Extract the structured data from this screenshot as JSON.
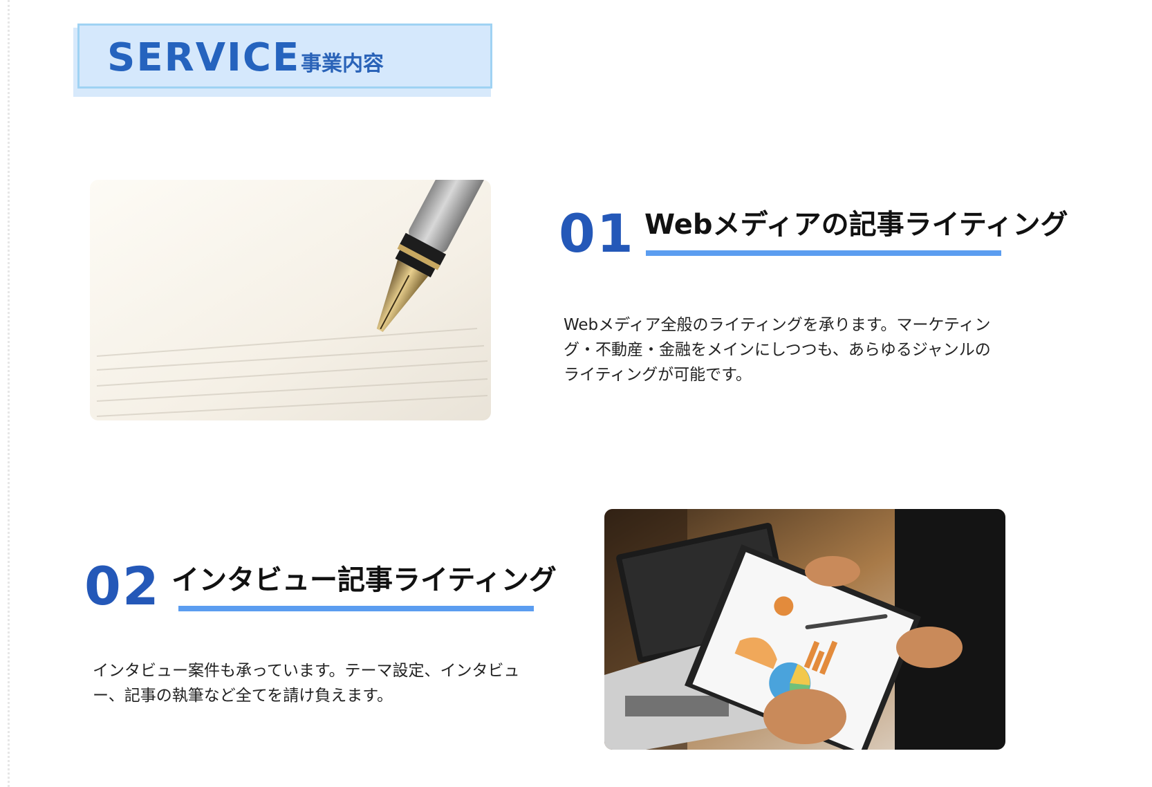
{
  "heading": {
    "en": "SERVICE",
    "ja": "事業内容"
  },
  "services": [
    {
      "number": "01",
      "title": "Webメディアの記事ライティング",
      "description": "Webメディア全般のライティングを承ります。マーケティング・不動産・金融をメインにしつつも、あらゆるジャンルのライティングが可能です。",
      "image": "fountain-pen-writing-photo"
    },
    {
      "number": "02",
      "title": "インタビュー記事ライティング",
      "description": "インタビュー案件も承っています。テーマ設定、インタビュー、記事の執筆など全てを請け負えます。",
      "image": "business-meeting-charts-photo"
    }
  ],
  "colors": {
    "accent": "#2458b8",
    "underline": "#5b9df0",
    "heading_bg": "#d5e8fc",
    "heading_border": "#9fd2f3"
  }
}
